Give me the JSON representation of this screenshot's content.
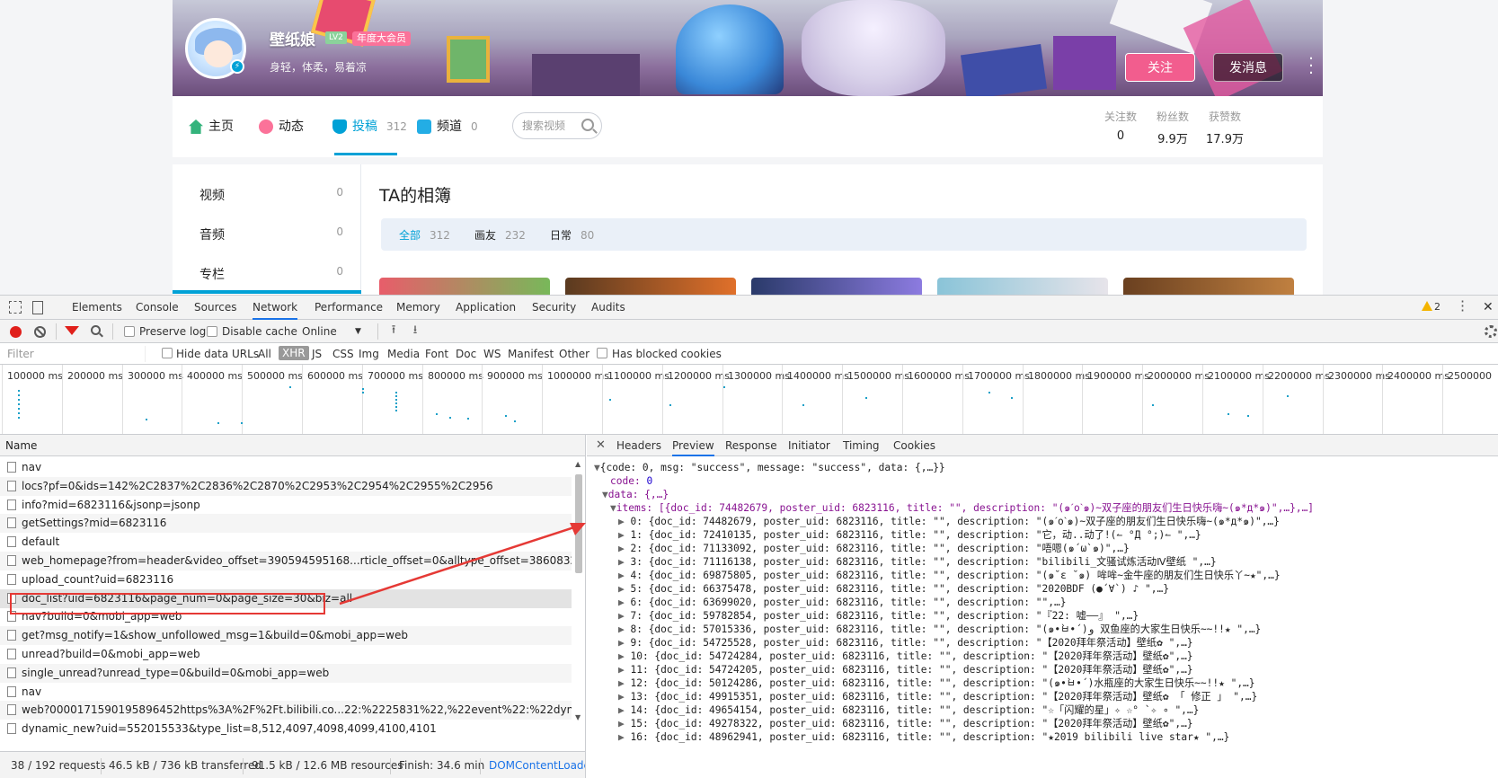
{
  "profile": {
    "username": "壁纸娘",
    "level": "LV2",
    "vip_badge": "年度大会员",
    "signature": "身轻，体柔，易着凉",
    "follow_button": "关注",
    "message_button": "发消息"
  },
  "nav": {
    "items": [
      {
        "label": "主页",
        "count": ""
      },
      {
        "label": "动态",
        "count": ""
      },
      {
        "label": "投稿",
        "count": "312"
      },
      {
        "label": "频道",
        "count": "0"
      }
    ],
    "search_placeholder": "搜索视频",
    "stats": [
      {
        "label": "关注数",
        "value": "0"
      },
      {
        "label": "粉丝数",
        "value": "9.9万"
      },
      {
        "label": "获赞数",
        "value": "17.9万"
      }
    ]
  },
  "sidebar": {
    "items": [
      {
        "label": "视频",
        "count": "0"
      },
      {
        "label": "音频",
        "count": "0"
      },
      {
        "label": "专栏",
        "count": "0"
      }
    ]
  },
  "album": {
    "title": "TA的相簿",
    "filters": [
      {
        "label": "全部",
        "count": "312"
      },
      {
        "label": "画友",
        "count": "232"
      },
      {
        "label": "日常",
        "count": "80"
      }
    ]
  },
  "devtools": {
    "tabs": [
      "Elements",
      "Console",
      "Sources",
      "Network",
      "Performance",
      "Memory",
      "Application",
      "Security",
      "Audits"
    ],
    "active_tab": "Network",
    "warning_count": "2",
    "toolbar": {
      "preserve_log": "Preserve log",
      "disable_cache": "Disable cache",
      "throttle": "Online"
    },
    "filter": {
      "placeholder": "Filter",
      "hide_data_urls": "Hide data URLs",
      "types": [
        "All",
        "XHR",
        "JS",
        "CSS",
        "Img",
        "Media",
        "Font",
        "Doc",
        "WS",
        "Manifest",
        "Other"
      ],
      "active_type": "XHR",
      "blocked_cookies": "Has blocked cookies"
    },
    "timeline_labels": [
      "100000 ms",
      "200000 ms",
      "300000 ms",
      "400000 ms",
      "500000 ms",
      "600000 ms",
      "700000 ms",
      "800000 ms",
      "900000 ms",
      "1000000 ms",
      "1100000 ms",
      "1200000 ms",
      "1300000 ms",
      "1400000 ms",
      "1500000 ms",
      "1600000 ms",
      "1700000 ms",
      "1800000 ms",
      "1900000 ms",
      "2000000 ms",
      "2100000 ms",
      "2200000 ms",
      "2300000 ms",
      "2400000 ms",
      "2500000"
    ],
    "name_header": "Name",
    "requests": [
      "nav",
      "locs?pf=0&ids=142%2C2837%2C2836%2C2870%2C2953%2C2954%2C2955%2C2956",
      "info?mid=6823116&jsonp=jsonp",
      "getSettings?mid=6823116",
      "default",
      "web_homepage?from=header&video_offset=390594595168...rticle_offset=0&alltype_offset=386083200176255807",
      "upload_count?uid=6823116",
      "doc_list?uid=6823116&page_num=0&page_size=30&biz=all",
      "nav?build=0&mobi_app=web",
      "get?msg_notify=1&show_unfollowed_msg=1&build=0&mobi_app=web",
      "unread?build=0&mobi_app=web",
      "single_unread?unread_type=0&build=0&mobi_app=web",
      "nav",
      "web?000017159019589645​2https%3A%2F%2Ft.bilibili.co...22:%2225831%22,%22event%22:%22dynamic_tab_int%22}",
      "dynamic_new?uid=552015533&type_list=8,512,4097,4098,4099,4100,4101"
    ],
    "selected_request": 7,
    "status": {
      "requests": "38 / 192 requests",
      "transferred": "46.5 kB / 736 kB transferred",
      "resources": "91.5 kB / 12.6 MB resources",
      "finish": "Finish: 34.6 min",
      "dcl": "DOMContentLoade"
    },
    "detail_tabs": [
      "Headers",
      "Preview",
      "Response",
      "Initiator",
      "Timing",
      "Cookies"
    ],
    "active_detail_tab": "Preview",
    "preview": {
      "root": "{code: 0, msg: \"success\", message: \"success\", data: {,…}}",
      "code_key": "code:",
      "code_val": "0",
      "data_line": "data: {,…}",
      "items_line": "items: [{doc_id: 74482679, poster_uid: 6823116, title: \"\", description: \"(๑ˊoˋ๑)~双子座的朋友们生日快乐嗨~(๑*д*๑)\",…},…]",
      "items": [
        "0: {doc_id: 74482679, poster_uid: 6823116, title: \"\", description: \"(๑ˊoˋ๑)~双子座的朋友们生日快乐嗨~(๑*д*๑)\",…}",
        "1: {doc_id: 72410135, poster_uid: 6823116, title: \"\", description: \"它，动..动了!(↼ °Д °;)↼ \",…}",
        "2: {doc_id: 71133092, poster_uid: 6823116, title: \"\", description: \"唔嗯(๑´ω`๑)\",…}",
        "3: {doc_id: 71116138, poster_uid: 6823116, title: \"\", description: \"bilibili_文骚试炼活动Ⅳ壁纸 \",…}",
        "4: {doc_id: 69875805, poster_uid: 6823116, title: \"\", description: \"(๑˘ε ˘๑) 哞哞~金牛座的朋友们生日快乐丫~★\",…}",
        "5: {doc_id: 66375478, poster_uid: 6823116, title: \"\", description: \"2020BDF (●´∀`) ♪ \",…}",
        "6: {doc_id: 63699020, poster_uid: 6823116, title: \"\", description: \"\",…}",
        "7: {doc_id: 59782854, poster_uid: 6823116, title: \"\", description: \"『22: 嘘——』 \",…}",
        "8: {doc_id: 57015336, poster_uid: 6823116, title: \"\", description: \"(๑•̀ㅂ•́)و 双鱼座的大家生日快乐~~!!★ \",…}",
        "9: {doc_id: 54725528, poster_uid: 6823116, title: \"\", description: \"【2020拜年祭活动】壁纸✿ \",…}",
        "10: {doc_id: 54724284, poster_uid: 6823116, title: \"\", description: \"【2020拜年祭活动】壁纸✿\",…}",
        "11: {doc_id: 54724205, poster_uid: 6823116, title: \"\", description: \"【2020拜年祭活动】壁纸✿\",…}",
        "12: {doc_id: 50124286, poster_uid: 6823116, title: \"\", description: \"(๑•̀ㅂ•́)水瓶座的大家生日快乐~~!!★ \",…}",
        "13: {doc_id: 49915351, poster_uid: 6823116, title: \"\", description: \"【2020拜年祭活动】壁纸✿ 「 修正 」 \",…}",
        "14: {doc_id: 49654154, poster_uid: 6823116, title: \"\", description: \"☆「闪耀的星」✧ ☆° `✧ ∘ \",…}",
        "15: {doc_id: 49278322, poster_uid: 6823116, title: \"\", description: \"【2020拜年祭活动】壁纸✿\",…}",
        "16: {doc_id: 48962941, poster_uid: 6823116, title: \"\", description: \"★2019 bilibili live star★ \",…}"
      ]
    }
  },
  "colors": {
    "accent": "#00a1d6",
    "pink": "#f25d8e",
    "devtools_blue": "#1a73e8",
    "annotation_red": "#e53935"
  }
}
